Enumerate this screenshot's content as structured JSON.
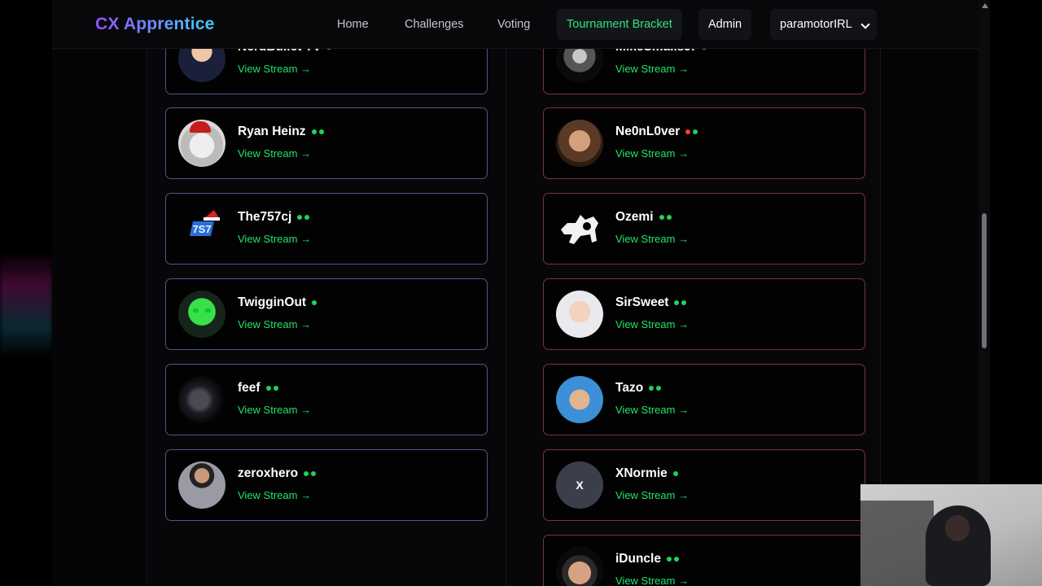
{
  "nav": {
    "brand": "CX Apprentice",
    "links": [
      "Home",
      "Challenges",
      "Voting",
      "Tournament Bracket",
      "Admin"
    ],
    "user": "paramotorIRL"
  },
  "stream_link": "View Stream →",
  "left_column": [
    {
      "name": "NerdBullet TV",
      "dots": [
        "green"
      ]
    },
    {
      "name": "Ryan Heinz",
      "dots": [
        "green",
        "green"
      ]
    },
    {
      "name": "The757cj",
      "dots": [
        "green",
        "green"
      ]
    },
    {
      "name": "TwigginOut",
      "dots": [
        "green"
      ]
    },
    {
      "name": "feef",
      "dots": [
        "green",
        "green"
      ]
    },
    {
      "name": "zeroxhero",
      "dots": [
        "green",
        "green"
      ]
    }
  ],
  "right_column": [
    {
      "name": "MikeSmallsJr",
      "dots": [
        "green"
      ]
    },
    {
      "name": "Ne0nL0ver",
      "dots": [
        "red",
        "green"
      ]
    },
    {
      "name": "Ozemi",
      "dots": [
        "green",
        "green"
      ]
    },
    {
      "name": "SirSweet",
      "dots": [
        "green",
        "green"
      ]
    },
    {
      "name": "Tazo",
      "dots": [
        "green",
        "green"
      ]
    },
    {
      "name": "XNormie",
      "avatar_letter": "X",
      "dots": [
        "green"
      ]
    },
    {
      "name": "iDuncle",
      "dots": [
        "green",
        "green"
      ]
    }
  ],
  "colors": {
    "accent_green": "#22e36a",
    "left_border": "#4a5a88",
    "right_border": "#7a3438"
  }
}
